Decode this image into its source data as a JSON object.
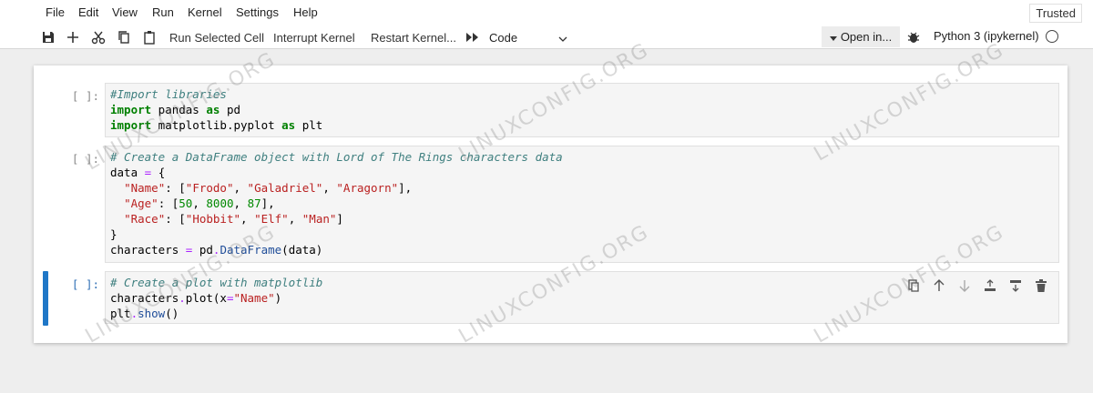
{
  "menubar": {
    "items": [
      "File",
      "Edit",
      "View",
      "Run",
      "Kernel",
      "Settings",
      "Help"
    ],
    "trusted": "Trusted"
  },
  "toolbar": {
    "icons": [
      "save-icon",
      "add-icon",
      "cut-icon",
      "copy-icon",
      "paste-icon",
      "run-all-icon",
      "debug-icon"
    ],
    "run_selected": "Run Selected Cell",
    "interrupt": "Interrupt Kernel",
    "restart": "Restart Kernel...",
    "cell_type": "Code",
    "open_in": "Open in...",
    "kernel": "Python 3 (ipykernel)"
  },
  "cells": [
    {
      "prompt": "[ ]:",
      "lines": [
        "#Import libraries",
        "import pandas as pd",
        "import matplotlib.pyplot as plt"
      ]
    },
    {
      "prompt": "[ ]:",
      "lines": [
        "# Create a DataFrame object with Lord of The Rings characters data",
        "data = {",
        "  \"Name\": [\"Frodo\", \"Galadriel\", \"Aragorn\"],",
        "  \"Age\": [50, 8000, 87],",
        "  \"Race\": [\"Hobbit\", \"Elf\", \"Man\"]",
        "}",
        "characters = pd.DataFrame(data)"
      ]
    },
    {
      "prompt": "[ ]:",
      "lines": [
        "# Create a plot with matplotlib",
        "characters.plot(x=\"Name\")",
        "plt.show()"
      ]
    }
  ],
  "cell_tools": [
    "duplicate-icon",
    "move-up-icon",
    "move-down-icon",
    "insert-above-icon",
    "insert-below-icon",
    "delete-icon"
  ],
  "watermark": "LINUXCONFIG.ORG",
  "colors": {
    "active_cell": "#1f77c7",
    "comment": "#408080",
    "keyword": "#008000",
    "string": "#ba2121",
    "number": "#008800"
  }
}
